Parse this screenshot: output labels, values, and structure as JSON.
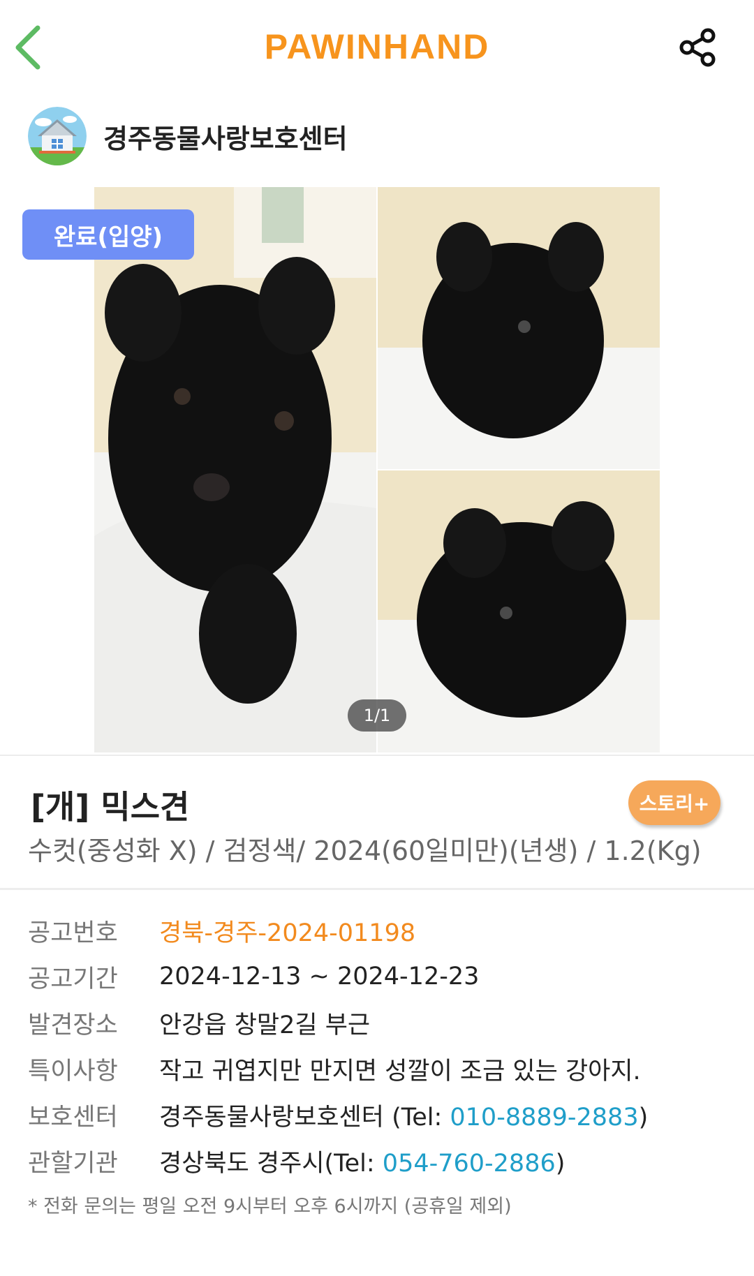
{
  "header": {
    "logo": "PAWINHAND",
    "logo_color": "#f7941d",
    "back_icon": "chevron-left-icon",
    "back_color": "#5dbb63",
    "share_icon": "share-icon"
  },
  "shelter": {
    "name": "경주동물사랑보호센터",
    "avatar_icon": "house-icon"
  },
  "photo": {
    "status_badge": "완료(입양)",
    "page_indicator": "1/1"
  },
  "animal": {
    "title": "[개] 믹스견",
    "story_button": "스토리+",
    "summary": "수컷(중성화 X) / 검정색/ 2024(60일미만)(년생) / 1.2(Kg)"
  },
  "info": {
    "notice_no": {
      "label": "공고번호",
      "value": "경북-경주-2024-01198"
    },
    "period": {
      "label": "공고기간",
      "value": "2024-12-13 ~ 2024-12-23"
    },
    "found_place": {
      "label": "발견장소",
      "value": "안강읍 창말2길 부근"
    },
    "notes": {
      "label": "특이사항",
      "value": "작고 귀엽지만 만지면 성깔이 조금 있는 강아지."
    },
    "shelter": {
      "label": "보호센터",
      "name": "경주동물사랑보호센터 (Tel: ",
      "phone": "010-8889-2883",
      "suffix": ")"
    },
    "authority": {
      "label": "관할기관",
      "name": "경상북도 경주시(Tel: ",
      "phone": "054-760-2886",
      "suffix": ")"
    }
  },
  "footnote": "* 전화 문의는 평일 오전 9시부터 오후 6시까지 (공휴일 제외)"
}
